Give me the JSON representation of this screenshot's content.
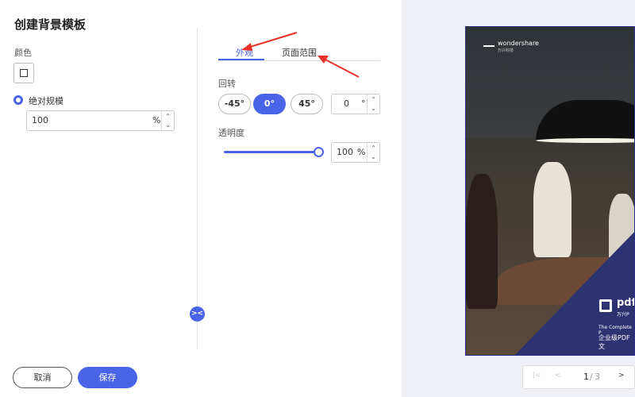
{
  "dialog": {
    "title": "创建背景模板",
    "color_label": "颜色",
    "scale_mode_label": "绝对规模",
    "scale_value": "100",
    "scale_unit": "%",
    "tabs": [
      {
        "label": "外观",
        "active": true
      },
      {
        "label": "页面范围",
        "active": false
      }
    ],
    "rotation_label": "回转",
    "rotation_buttons": [
      "-45°",
      "0°",
      "45°"
    ],
    "rotation_selected": "0°",
    "rotation_value": "0",
    "rotation_unit": "°",
    "opacity_label": "透明度",
    "opacity_value": "100",
    "opacity_unit": "%",
    "opacity_level": 1.0,
    "cancel_label": "取消",
    "save_label": "保存",
    "collapse_glyph": "><"
  },
  "preview": {
    "brand": "wondershare",
    "brand_sub": "万兴科技",
    "product": "pdf",
    "product_sub": "万兴P",
    "slogan_en": "The Complete P",
    "slogan_cn": "企业级PDF文",
    "pager": {
      "first": "|<",
      "prev": "<",
      "current": "1",
      "separator": "/",
      "total": "3",
      "next": ">"
    }
  },
  "colors": {
    "accent": "#4a64e8",
    "annotation_arrow": "#e8312a",
    "preview_bg": "#eef0f5",
    "brand_navy": "#2d3270"
  }
}
